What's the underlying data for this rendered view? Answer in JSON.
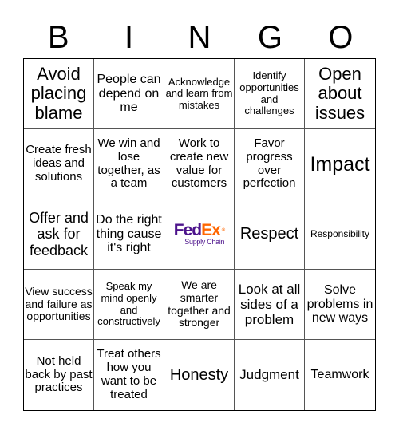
{
  "header": {
    "letters": [
      "B",
      "I",
      "N",
      "G",
      "O"
    ]
  },
  "free_space": {
    "brand_left": "Fed",
    "brand_right": "Ex",
    "registered": "®",
    "subtitle": "Supply Chain"
  },
  "cells": [
    "Avoid placing blame",
    "People can depend on me",
    "Acknowledge and learn from mistakes",
    "Identify opportunities and challenges",
    "Open about issues",
    "Create fresh ideas and solutions",
    "We win and lose together, as a team",
    "Work to create new value for customers",
    "Favor progress over perfection",
    "Impact",
    "Offer and ask for feedback",
    "Do the right thing cause it's right",
    "",
    "Respect",
    "Responsibility",
    "View success and failure as opportunities",
    "Speak my mind openly and constructively",
    "We are smarter together and stronger",
    "Look at all sides of a problem",
    "Solve problems in new ways",
    "Not held back by past practices",
    "Treat others how you want to be treated",
    "Honesty",
    "Judgment",
    "Teamwork"
  ]
}
